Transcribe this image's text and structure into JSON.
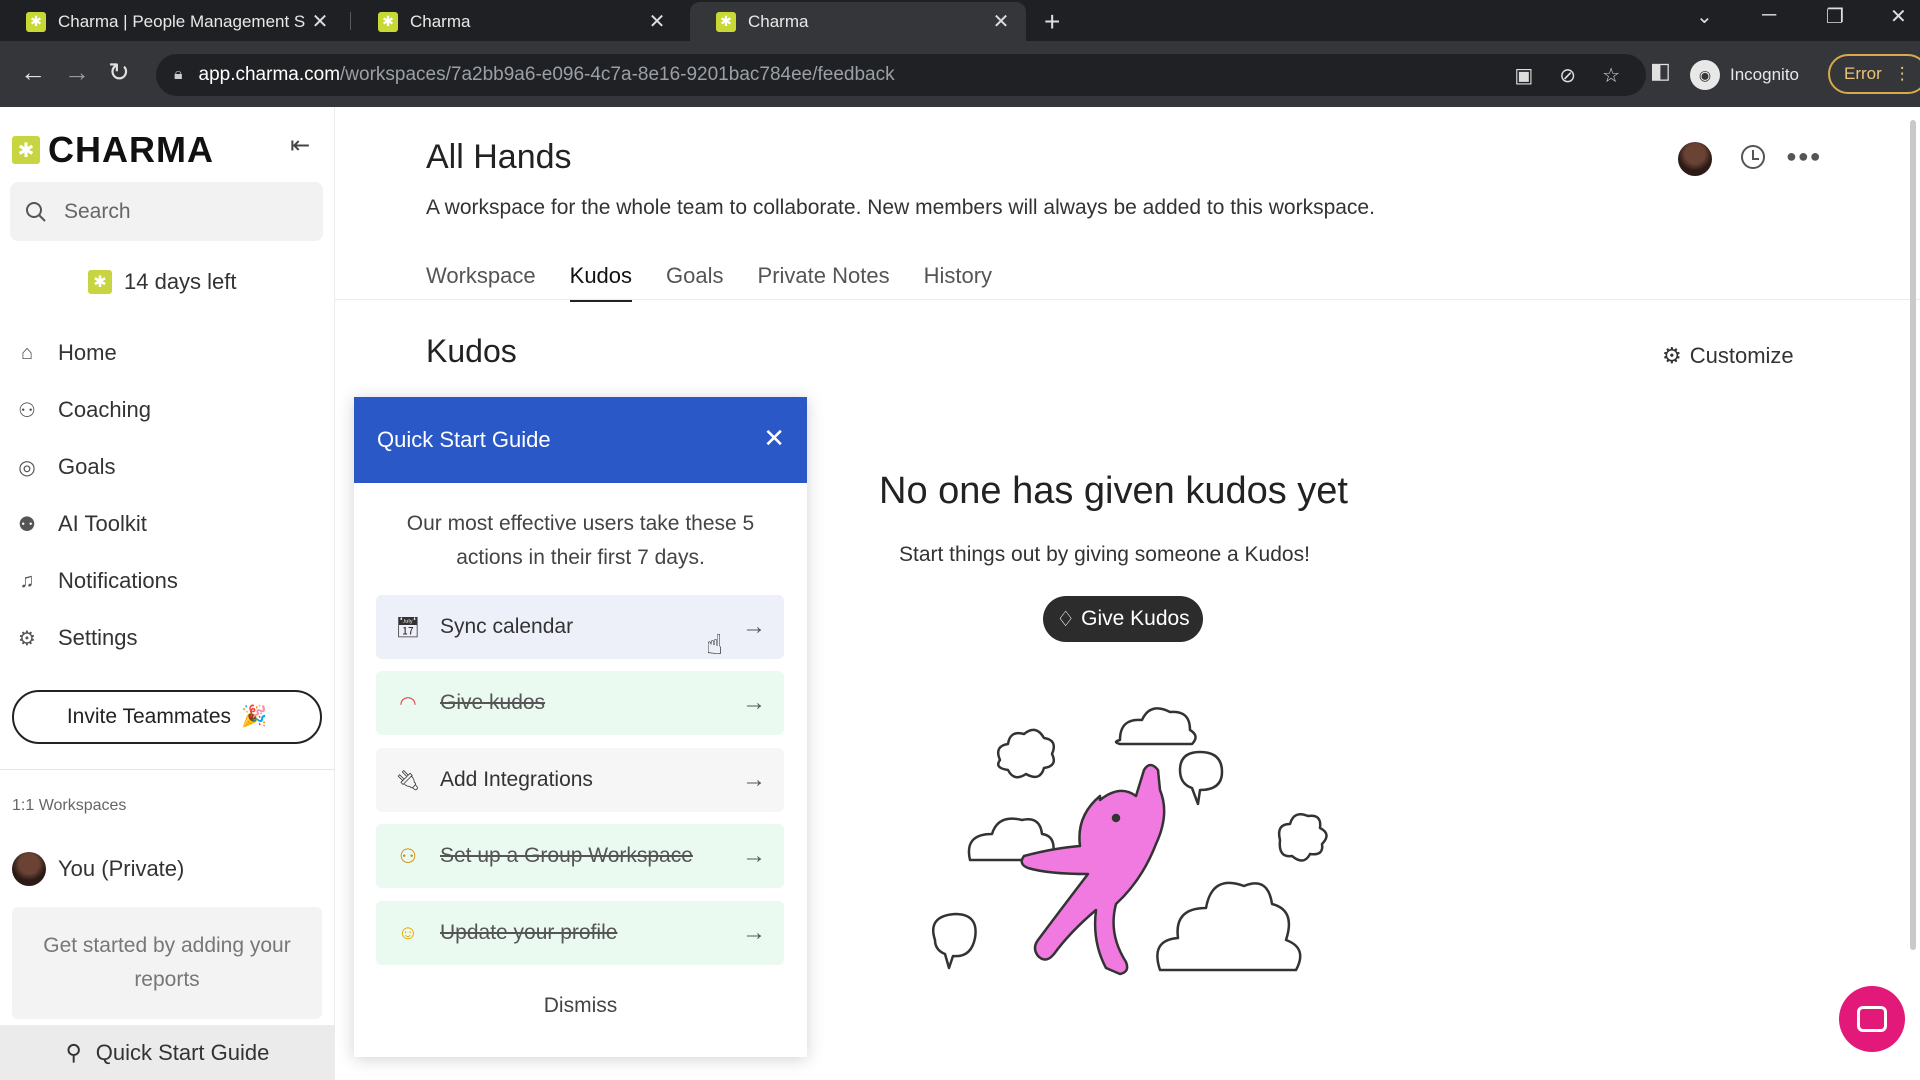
{
  "browser": {
    "tabs": [
      {
        "title": "Charma | People Management S",
        "active": false
      },
      {
        "title": "Charma",
        "active": false
      },
      {
        "title": "Charma",
        "active": true
      }
    ],
    "url_host": "app.charma.com",
    "url_path": "/workspaces/7a2bb9a6-e096-4c7a-8e16-9201bac784ee/feedback",
    "incognito_label": "Incognito",
    "error_label": "Error"
  },
  "sidebar": {
    "logo": "CHARMA",
    "search_placeholder": "Search",
    "trial": "14 days left",
    "nav": [
      {
        "label": "Home",
        "icon": "home-icon"
      },
      {
        "label": "Coaching",
        "icon": "coaching-icon"
      },
      {
        "label": "Goals",
        "icon": "target-icon"
      },
      {
        "label": "AI Toolkit",
        "icon": "robot-icon"
      },
      {
        "label": "Notifications",
        "icon": "bell-icon"
      },
      {
        "label": "Settings",
        "icon": "gear-icon"
      }
    ],
    "invite_label": "Invite Teammates",
    "workspaces_label": "1:1 Workspaces",
    "private_workspace": "You (Private)",
    "reports_hint": "Get started by adding your reports",
    "quick_start": "Quick Start Guide"
  },
  "main": {
    "title": "All Hands",
    "description": "A workspace for the whole team to collaborate. New members will always be added to this workspace.",
    "tabs": [
      "Workspace",
      "Kudos",
      "Goals",
      "Private Notes",
      "History"
    ],
    "active_tab": "Kudos",
    "section_title": "Kudos",
    "customize_label": "Customize",
    "empty_title": "No one has given kudos yet",
    "empty_subtitle": "Start things out by giving someone a Kudos!",
    "give_kudos_label": "Give Kudos"
  },
  "quick_start_guide": {
    "title": "Quick Start Guide",
    "intro": "Our most effective users take these 5 actions in their first 7 days.",
    "items": [
      {
        "label": "Sync calendar",
        "icon": "calendar-icon",
        "state": "active"
      },
      {
        "label": "Give kudos",
        "icon": "rainbow-icon",
        "state": "done"
      },
      {
        "label": "Add Integrations",
        "icon": "plug-icon",
        "state": "todo"
      },
      {
        "label": "Set up a Group Workspace",
        "icon": "group-icon",
        "state": "done"
      },
      {
        "label": "Update your profile",
        "icon": "smiley-icon",
        "state": "done"
      }
    ],
    "dismiss_label": "Dismiss"
  }
}
